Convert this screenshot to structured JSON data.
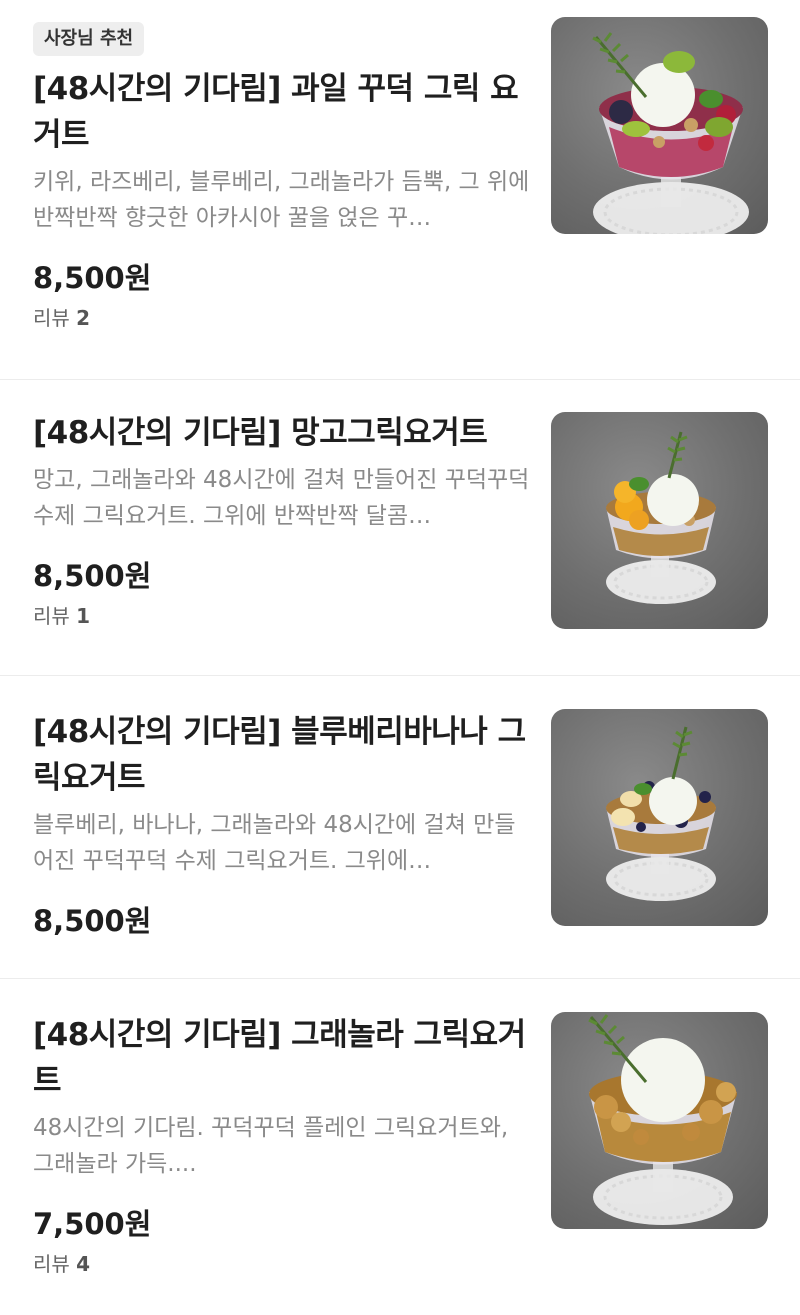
{
  "items": [
    {
      "badge": "사장님 추천",
      "title": "[48시간의 기다림] 과일 꾸덕 그릭 요거트",
      "description": "키위, 라즈베리, 블루베리, 그래놀라가 듬뿍, 그 위에 반짝반짝 향긋한 아카시아 꿀을 얹은 꾸…",
      "price": "8,500원",
      "review_label": "리뷰",
      "review_count": "2",
      "image": "fruit-yogurt-photo"
    },
    {
      "title": "[48시간의 기다림] 망고그릭요거트",
      "description": "망고, 그래놀라와 48시간에 걸쳐 만들어진 꾸덕꾸덕 수제 그릭요거트. 그위에 반짝반짝 달콤…",
      "price": "8,500원",
      "review_label": "리뷰",
      "review_count": "1",
      "image": "mango-yogurt-photo"
    },
    {
      "title": "[48시간의 기다림] 블루베리바나나 그릭요거트",
      "description": "블루베리, 바나나, 그래놀라와 48시간에 걸쳐 만들어진 꾸덕꾸덕 수제 그릭요거트. 그위에…",
      "price": "8,500원",
      "image": "blueberry-banana-yogurt-photo"
    },
    {
      "title": "[48시간의 기다림] 그래놀라 그릭요거트",
      "description": "48시간의 기다림. 꾸덕꾸덕 플레인 그릭요거트와, 그래놀라 가득....",
      "price": "7,500원",
      "review_label": "리뷰",
      "review_count": "4",
      "image": "granola-yogurt-photo"
    }
  ]
}
